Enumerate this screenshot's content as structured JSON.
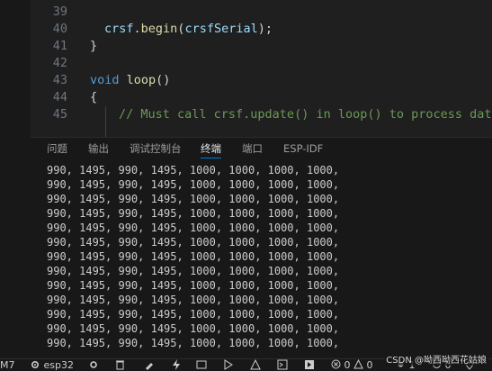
{
  "editor": {
    "lines": [
      {
        "num": "39",
        "tokens": []
      },
      {
        "num": "40",
        "tokens": [
          {
            "c": "var",
            "t": "crsf"
          },
          {
            "c": "pn",
            "t": "."
          },
          {
            "c": "fn",
            "t": "begin"
          },
          {
            "c": "pn",
            "t": "("
          },
          {
            "c": "var",
            "t": "crsfSerial"
          },
          {
            "c": "pn",
            "t": ");"
          }
        ]
      },
      {
        "num": "41",
        "tokens": [
          {
            "c": "pn",
            "t": "}"
          }
        ]
      },
      {
        "num": "42",
        "tokens": []
      },
      {
        "num": "43",
        "tokens": [
          {
            "c": "kw",
            "t": "void"
          },
          {
            "c": "pn",
            "t": " "
          },
          {
            "c": "fn",
            "t": "loop"
          },
          {
            "c": "pn",
            "t": "()"
          }
        ]
      },
      {
        "num": "44",
        "tokens": [
          {
            "c": "pn",
            "t": "{"
          }
        ]
      },
      {
        "num": "45",
        "tokens": [
          {
            "c": "cm",
            "t": "// Must call crsf.update() in loop() to process data"
          }
        ]
      }
    ]
  },
  "panel": {
    "tabs": [
      {
        "label": "问题"
      },
      {
        "label": "输出"
      },
      {
        "label": "调试控制台"
      },
      {
        "label": "终端"
      },
      {
        "label": "端口"
      },
      {
        "label": "ESP-IDF"
      }
    ],
    "active_tab": "终端",
    "terminal_lines": [
      "990, 1495, 990, 1495, 1000, 1000, 1000, 1000,",
      "990, 1495, 990, 1495, 1000, 1000, 1000, 1000,",
      "990, 1495, 990, 1495, 1000, 1000, 1000, 1000,",
      "990, 1495, 990, 1495, 1000, 1000, 1000, 1000,",
      "990, 1495, 990, 1495, 1000, 1000, 1000, 1000,",
      "990, 1495, 990, 1495, 1000, 1000, 1000, 1000,",
      "990, 1495, 990, 1495, 1000, 1000, 1000, 1000,",
      "990, 1495, 990, 1495, 1000, 1000, 1000, 1000,",
      "990, 1495, 990, 1495, 1000, 1000, 1000, 1000,",
      "990, 1495, 990, 1495, 1000, 1000, 1000, 1000,",
      "990, 1495, 990, 1495, 1000, 1000, 1000, 1000,",
      "990, 1495, 990, 1495, 1000, 1000, 1000, 1000,",
      "990, 1495, 990, 1495, 1000, 1000, 1000, 1000,"
    ]
  },
  "statusbar": {
    "port": "M7",
    "board": "esp32",
    "errors": "0",
    "warnings": "0",
    "problems_count": "1",
    "ports_count": "0"
  },
  "watermark": "CSDN @呦西呦西花姑娘"
}
